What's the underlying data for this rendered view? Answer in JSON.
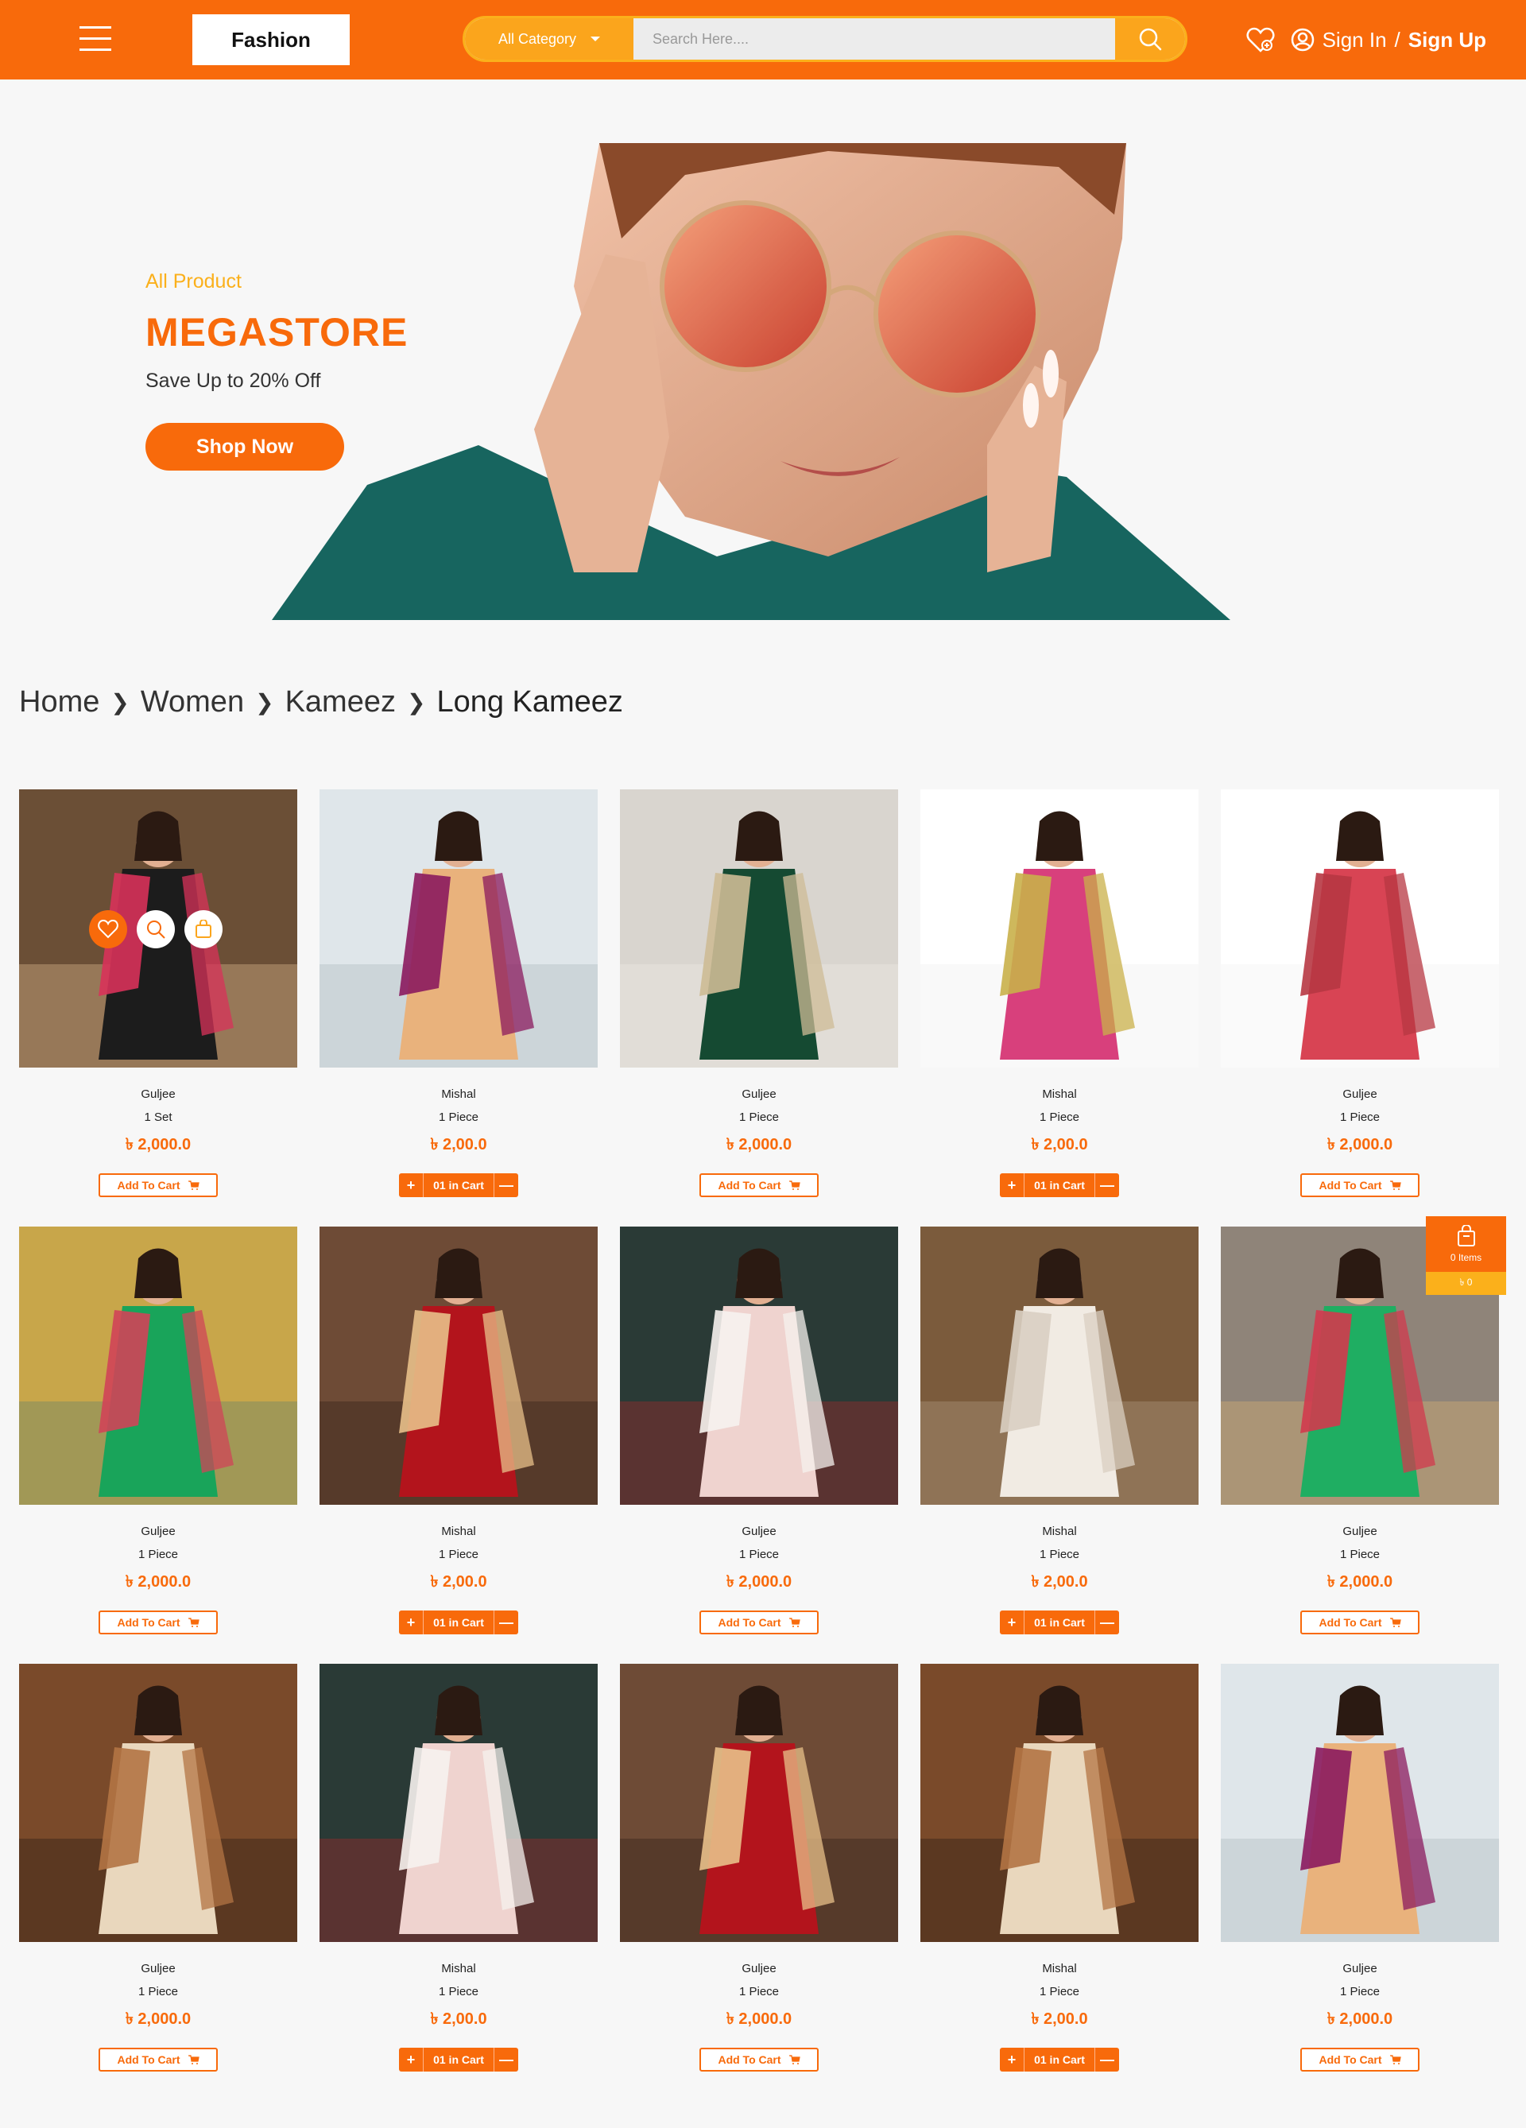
{
  "header": {
    "logo": "Fashion",
    "category_label": "All Category",
    "search_placeholder": "Search Here....",
    "sign_in": "Sign In",
    "separator": "/",
    "sign_up": "Sign Up"
  },
  "hero": {
    "subtitle": "All Product",
    "title": "MEGASTORE",
    "description": "Save Up to 20% Off",
    "cta": "Shop Now"
  },
  "breadcrumb": [
    "Home",
    "Women",
    "Kameez",
    "Long Kameez"
  ],
  "products": [
    {
      "brand": "Guljee",
      "unit": "1 Set",
      "price": "৳ 2,000.0",
      "state": "add",
      "img": "p1"
    },
    {
      "brand": "Mishal",
      "unit": "1 Piece",
      "price": "৳ 2,00.0",
      "state": "incart",
      "img": "p2"
    },
    {
      "brand": "Guljee",
      "unit": "1 Piece",
      "price": "৳ 2,000.0",
      "state": "add",
      "img": "p3"
    },
    {
      "brand": "Mishal",
      "unit": "1 Piece",
      "price": "৳ 2,00.0",
      "state": "incart",
      "img": "p4"
    },
    {
      "brand": "Guljee",
      "unit": "1 Piece",
      "price": "৳ 2,000.0",
      "state": "add",
      "img": "p5"
    },
    {
      "brand": "Guljee",
      "unit": "1 Piece",
      "price": "৳ 2,000.0",
      "state": "add",
      "img": "p6"
    },
    {
      "brand": "Mishal",
      "unit": "1 Piece",
      "price": "৳ 2,00.0",
      "state": "incart",
      "img": "p7"
    },
    {
      "brand": "Guljee",
      "unit": "1 Piece",
      "price": "৳ 2,000.0",
      "state": "add",
      "img": "p8"
    },
    {
      "brand": "Mishal",
      "unit": "1 Piece",
      "price": "৳ 2,00.0",
      "state": "incart",
      "img": "p9"
    },
    {
      "brand": "Guljee",
      "unit": "1 Piece",
      "price": "৳ 2,000.0",
      "state": "add",
      "img": "p10"
    },
    {
      "brand": "Guljee",
      "unit": "1 Piece",
      "price": "৳ 2,000.0",
      "state": "add",
      "img": "p11"
    },
    {
      "brand": "Mishal",
      "unit": "1 Piece",
      "price": "৳ 2,00.0",
      "state": "incart",
      "img": "p12"
    },
    {
      "brand": "Guljee",
      "unit": "1 Piece",
      "price": "৳ 2,000.0",
      "state": "add",
      "img": "p13"
    },
    {
      "brand": "Mishal",
      "unit": "1 Piece",
      "price": "৳ 2,00.0",
      "state": "incart",
      "img": "p14"
    },
    {
      "brand": "Guljee",
      "unit": "1 Piece",
      "price": "৳ 2,000.0",
      "state": "add",
      "img": "p15"
    }
  ],
  "labels": {
    "add_to_cart": "Add To Cart",
    "in_cart": "01 in Cart",
    "plus": "+",
    "minus": "—"
  },
  "floating_cart": {
    "items": "0 Items",
    "total": "৳ 0"
  },
  "colors": {
    "primary": "#f86a0b",
    "secondary": "#fbb01b"
  },
  "icons": {
    "header": [
      "menu-icon",
      "search-icon",
      "wishlist-icon",
      "user-icon"
    ],
    "card_overlay": [
      "heart-icon",
      "search-icon",
      "bag-icon"
    ],
    "floating": "shopping-bag-icon"
  }
}
